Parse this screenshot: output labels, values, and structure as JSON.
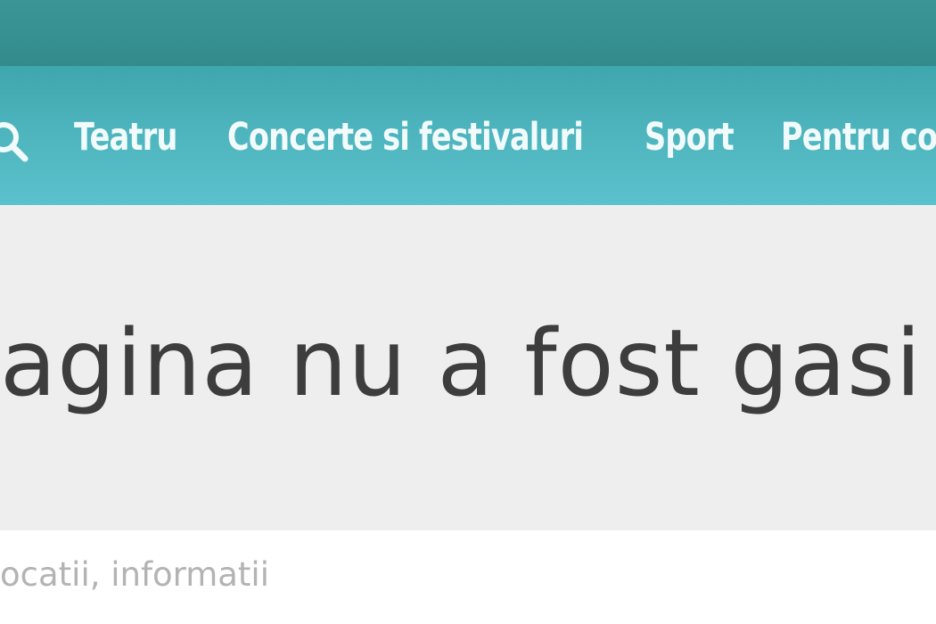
{
  "header": {
    "nav": {
      "search_icon": "search-icon",
      "items": [
        {
          "label": "Teatru"
        },
        {
          "label": "Concerte si festivaluri"
        },
        {
          "label": "Sport"
        },
        {
          "label": "Pentru co"
        }
      ]
    }
  },
  "main": {
    "title": "agina nu a fost gasi"
  },
  "footer": {
    "text": "ocatii, informatii"
  },
  "colors": {
    "topbar": "#338b8c",
    "navbar": "#4db4bd",
    "hero_background": "#eeeeee",
    "title_text": "#3d3d3d",
    "footer_text": "#b3b3b3"
  }
}
